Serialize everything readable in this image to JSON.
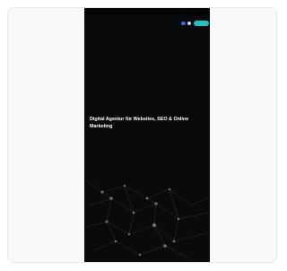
{
  "preview": {
    "topbar": {
      "left_text": "",
      "right_text": ""
    },
    "nav": {
      "logo": "",
      "links": [
        "",
        "",
        "",
        ""
      ],
      "cta_label": ""
    },
    "hero": {
      "title": "Digital Agentur für Websites, SEO & Online Marketing",
      "subtitle": "",
      "links": [
        "",
        "",
        "",
        ""
      ]
    }
  },
  "colors": {
    "page_background": "#090a0b",
    "accent": "#22c1c3",
    "card_background": "#f8f9fb"
  }
}
